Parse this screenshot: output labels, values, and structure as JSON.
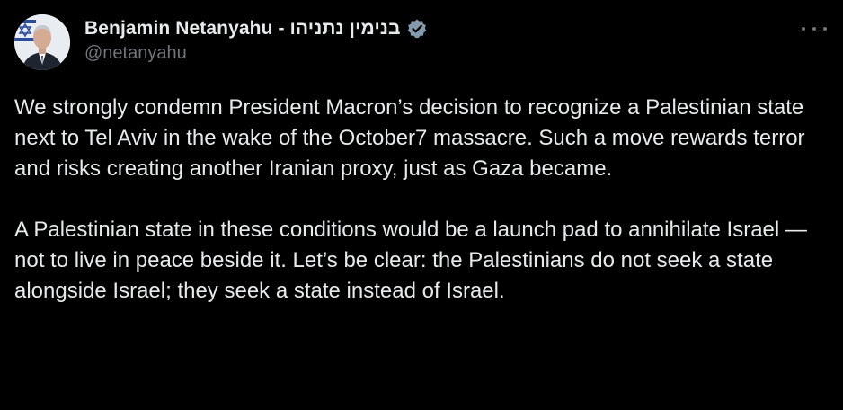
{
  "author": {
    "display_name": "Benjamin Netanyahu - בנימין נתניהו",
    "handle": "@netanyahu",
    "verified": true,
    "avatar_icon": "profile-photo-avatar"
  },
  "tweet": {
    "paragraphs": [
      "We strongly condemn President Macron’s decision to recognize a Palestinian state next to Tel Aviv in the wake of the October7 massacre. Such a move rewards terror and risks creating another Iranian proxy, just as Gaza became.",
      "A Palestinian state in these conditions would be a launch pad to annihilate Israel — not to live in peace beside it. Let’s be clear: the Palestinians do not seek a state alongside Israel; they seek a state instead of Israel."
    ]
  },
  "icons": {
    "verified": "verified-badge-icon",
    "more": "more-options-icon"
  },
  "colors": {
    "background": "#000000",
    "text_primary": "#e7e9ea",
    "text_secondary": "#71767b",
    "verified_badge": "#829aab"
  }
}
